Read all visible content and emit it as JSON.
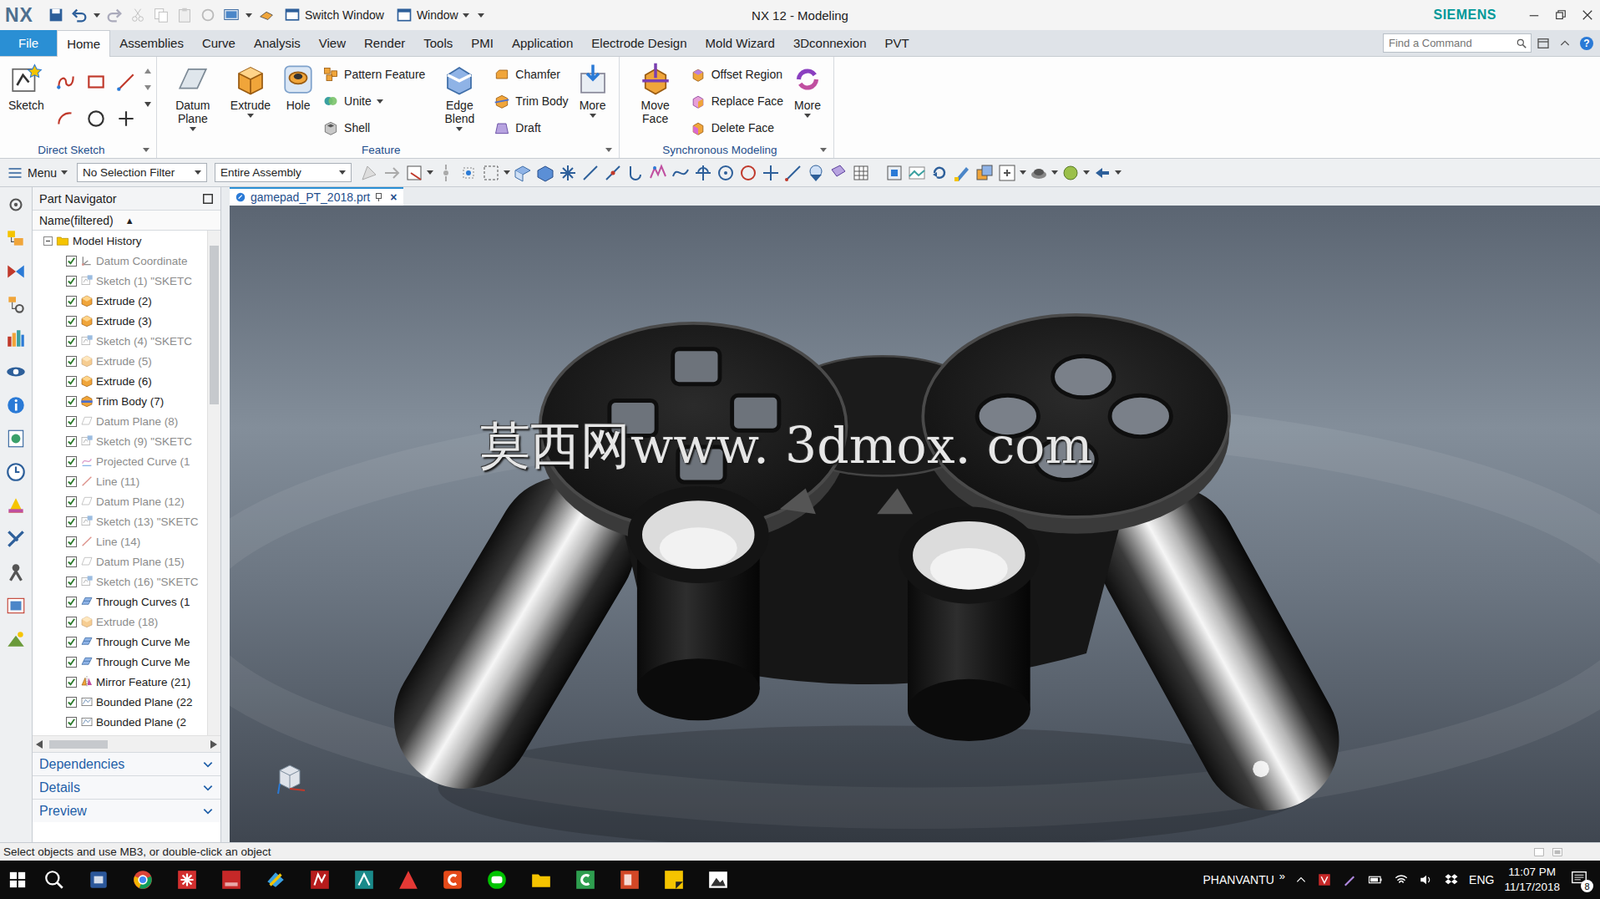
{
  "window": {
    "logo": "NX",
    "title": "NX 12 - Modeling",
    "brand": "SIEMENS",
    "switch_window": "Switch Window",
    "window_menu": "Window"
  },
  "ribbon": {
    "file": "File",
    "tabs": [
      {
        "label": "Home",
        "selected": true
      },
      {
        "label": "Assemblies",
        "selected": false
      },
      {
        "label": "Curve",
        "selected": false
      },
      {
        "label": "Analysis",
        "selected": false
      },
      {
        "label": "View",
        "selected": false
      },
      {
        "label": "Render",
        "selected": false
      },
      {
        "label": "Tools",
        "selected": false
      },
      {
        "label": "PMI",
        "selected": false
      },
      {
        "label": "Application",
        "selected": false
      },
      {
        "label": "Electrode Design",
        "selected": false
      },
      {
        "label": "Mold Wizard",
        "selected": false
      },
      {
        "label": "3Dconnexion",
        "selected": false
      },
      {
        "label": "PVT",
        "selected": false
      }
    ],
    "search": {
      "placeholder": "Find a Command"
    },
    "help": "?",
    "groups": [
      {
        "label": "Direct Sketch",
        "columns": [
          {
            "kind": "big",
            "tools": [
              {
                "label": "Sketch",
                "dropdown": false
              }
            ]
          },
          {
            "kind": "grid",
            "tools": []
          }
        ]
      },
      {
        "label": "Feature",
        "columns": [
          {
            "kind": "big",
            "tools": [
              {
                "label": "Datum Plane",
                "dropdown": true
              }
            ]
          },
          {
            "kind": "big",
            "tools": [
              {
                "label": "Extrude",
                "dropdown": true
              }
            ]
          },
          {
            "kind": "big",
            "tools": [
              {
                "label": "Hole",
                "dropdown": false
              }
            ]
          },
          {
            "kind": "stack",
            "tools": [
              {
                "label": "Pattern Feature",
                "dropdown": false
              },
              {
                "label": "Unite",
                "dropdown": true
              },
              {
                "label": "Shell",
                "dropdown": false
              }
            ]
          },
          {
            "kind": "big",
            "tools": [
              {
                "label": "Edge Blend",
                "dropdown": true
              }
            ]
          },
          {
            "kind": "stack",
            "tools": [
              {
                "label": "Chamfer",
                "dropdown": false
              },
              {
                "label": "Trim Body",
                "dropdown": false
              },
              {
                "label": "Draft",
                "dropdown": false
              }
            ]
          },
          {
            "kind": "big",
            "tools": [
              {
                "label": "More",
                "dropdown": true
              }
            ]
          }
        ]
      },
      {
        "label": "Synchronous Modeling",
        "columns": [
          {
            "kind": "big",
            "tools": [
              {
                "label": "Move Face",
                "dropdown": false
              }
            ]
          },
          {
            "kind": "stack",
            "tools": [
              {
                "label": "Offset Region",
                "dropdown": false
              },
              {
                "label": "Replace Face",
                "dropdown": false
              },
              {
                "label": "Delete Face",
                "dropdown": false
              }
            ]
          },
          {
            "kind": "big",
            "tools": [
              {
                "label": "More",
                "dropdown": true
              }
            ]
          }
        ]
      }
    ]
  },
  "toolbar": {
    "menu": "Menu",
    "selection_filter": "No Selection Filter",
    "scope": "Entire Assembly"
  },
  "navigator": {
    "title": "Part Navigator",
    "column": "Name(filtered)",
    "sort": "▲",
    "root": {
      "label": "Model History",
      "expanded": true
    },
    "items": [
      {
        "label": "Datum Coordinate",
        "kind": "datum_csys",
        "checked": true,
        "dimmed": true
      },
      {
        "label": "Sketch (1) \"SKETC",
        "kind": "sketch",
        "checked": true,
        "dimmed": true
      },
      {
        "label": "Extrude (2)",
        "kind": "extrude",
        "checked": true,
        "dimmed": false
      },
      {
        "label": "Extrude (3)",
        "kind": "extrude",
        "checked": true,
        "dimmed": false
      },
      {
        "label": "Sketch (4) \"SKETC",
        "kind": "sketch",
        "checked": true,
        "dimmed": true
      },
      {
        "label": "Extrude (5)",
        "kind": "extrude",
        "checked": true,
        "dimmed": true
      },
      {
        "label": "Extrude (6)",
        "kind": "extrude",
        "checked": true,
        "dimmed": false
      },
      {
        "label": "Trim Body (7)",
        "kind": "trim",
        "checked": true,
        "dimmed": false
      },
      {
        "label": "Datum Plane (8)",
        "kind": "datum_plane",
        "checked": true,
        "dimmed": true
      },
      {
        "label": "Sketch (9) \"SKETC",
        "kind": "sketch",
        "checked": true,
        "dimmed": true
      },
      {
        "label": "Projected Curve (1",
        "kind": "projected_curve",
        "checked": true,
        "dimmed": true
      },
      {
        "label": "Line (11)",
        "kind": "line",
        "checked": true,
        "dimmed": true
      },
      {
        "label": "Datum Plane (12)",
        "kind": "datum_plane",
        "checked": true,
        "dimmed": true
      },
      {
        "label": "Sketch (13) \"SKETC",
        "kind": "sketch",
        "checked": true,
        "dimmed": true
      },
      {
        "label": "Line (14)",
        "kind": "line",
        "checked": true,
        "dimmed": true
      },
      {
        "label": "Datum Plane (15)",
        "kind": "datum_plane",
        "checked": true,
        "dimmed": true
      },
      {
        "label": "Sketch (16) \"SKETC",
        "kind": "sketch",
        "checked": true,
        "dimmed": true
      },
      {
        "label": "Through Curves (1",
        "kind": "through_curves",
        "checked": true,
        "dimmed": false
      },
      {
        "label": "Extrude (18)",
        "kind": "extrude",
        "checked": true,
        "dimmed": true
      },
      {
        "label": "Through Curve Me",
        "kind": "through_curves",
        "checked": true,
        "dimmed": false
      },
      {
        "label": "Through Curve Me",
        "kind": "through_curves",
        "checked": true,
        "dimmed": false
      },
      {
        "label": "Mirror Feature (21)",
        "kind": "mirror",
        "checked": true,
        "dimmed": false
      },
      {
        "label": "Bounded Plane (22",
        "kind": "bounded_plane",
        "checked": true,
        "dimmed": false
      },
      {
        "label": "Bounded Plane (2",
        "kind": "bounded_plane",
        "checked": true,
        "dimmed": false
      }
    ],
    "sections": [
      {
        "label": "Dependencies",
        "expanded": false
      },
      {
        "label": "Details",
        "expanded": false
      },
      {
        "label": "Preview",
        "expanded": false
      }
    ]
  },
  "document_tab": {
    "label": "gamepad_PT_2018.prt",
    "selected": true,
    "close": "×"
  },
  "watermark": "莫西网www. 3dmox. com",
  "status_bar": {
    "prompt": "Select objects and use MB3, or double-click an object"
  },
  "taskbar": {
    "tray_label": "PHANVANTU",
    "tray_chevron": "»",
    "language": "ENG",
    "time": "11:07 PM",
    "date": "11/17/2018",
    "notifications": "8"
  }
}
